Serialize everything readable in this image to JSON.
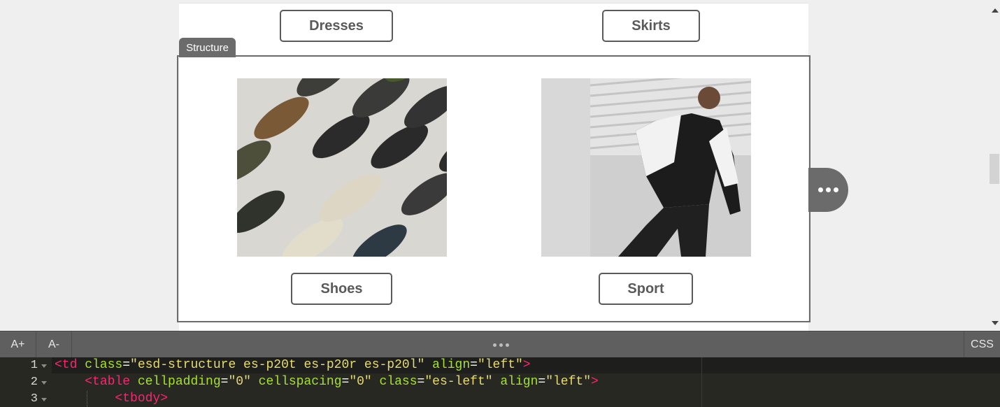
{
  "canvas": {
    "top_buttons": {
      "dresses": "Dresses",
      "skirts": "Skirts"
    },
    "structure_label": "Structure",
    "images": {
      "shoes": {
        "alt": "Shoes"
      },
      "sport": {
        "alt": "Sport"
      }
    },
    "bottom_buttons": {
      "shoes": "Shoes",
      "sport": "Sport"
    },
    "more_icon": "ellipsis-icon"
  },
  "toolbar": {
    "font_increase": "A+",
    "font_decrease": "A-",
    "css": "CSS"
  },
  "editor": {
    "line_numbers": [
      "1",
      "2",
      "3"
    ],
    "lines": [
      {
        "tag_open": "<td",
        "a1": " class",
        "eq1": "=",
        "v1": "\"esd-structure es-p20t es-p20r es-p20l\"",
        "a2": " align",
        "eq2": "=",
        "v2": "\"left\"",
        "close": ">"
      },
      {
        "indent": "    ",
        "tag_open": "<table",
        "a1": " cellpadding",
        "eq1": "=",
        "v1": "\"0\"",
        "a2": " cellspacing",
        "eq2": "=",
        "v2": "\"0\"",
        "a3": " class",
        "eq3": "=",
        "v3": "\"es-left\"",
        "a4": " align",
        "eq4": "=",
        "v4": "\"left\"",
        "close": ">"
      },
      {
        "indent": "        ",
        "tag_open": "<tbody>"
      }
    ]
  }
}
